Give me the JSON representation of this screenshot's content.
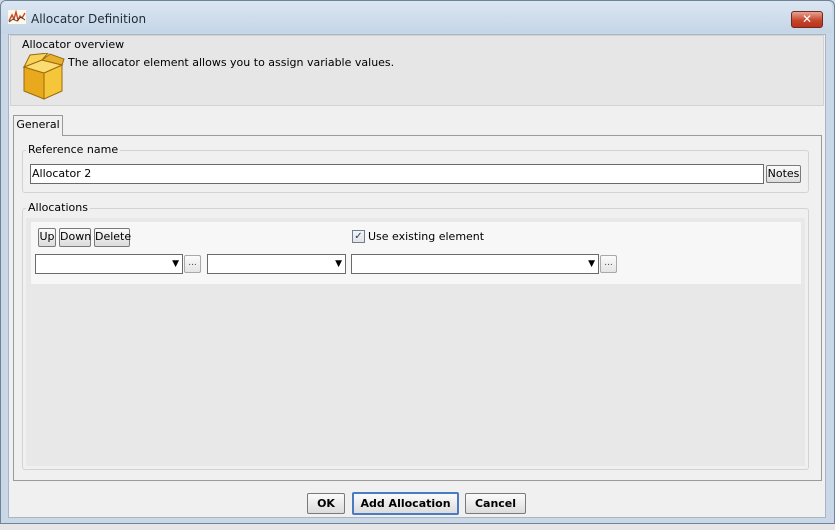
{
  "window": {
    "title": "Allocator Definition",
    "close_symbol": "✕"
  },
  "overview": {
    "title": "Allocator overview",
    "description": "The allocator element allows you to assign variable values.",
    "icon": "box-icon"
  },
  "tabs": [
    {
      "label": "General",
      "selected": true
    }
  ],
  "reference": {
    "legend": "Reference name",
    "value": "Allocator 2",
    "notes_label": "Notes"
  },
  "allocations": {
    "legend": "Allocations",
    "up_label": "Up",
    "down_label": "Down",
    "delete_label": "Delete",
    "use_existing_label": "Use existing element",
    "use_existing_checked": true,
    "check_mark": "✓",
    "combo1_value": "",
    "combo2_value": "",
    "combo3_value": "",
    "dropdown_arrow": "▼",
    "browse_label": "..."
  },
  "footer": {
    "ok_label": "OK",
    "add_allocation_label": "Add Allocation",
    "cancel_label": "Cancel"
  },
  "colors": {
    "title_bar": "#c5d5e6",
    "close_button": "#c7472d",
    "focus_border": "#4a7ac2",
    "dialog_background": "#f0f0f0"
  }
}
